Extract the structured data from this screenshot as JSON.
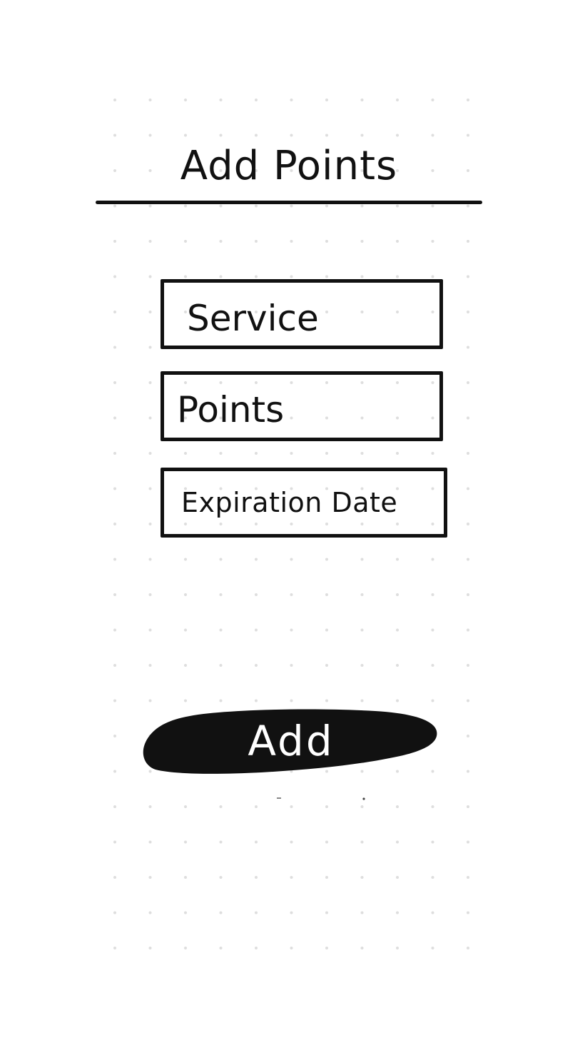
{
  "screen": {
    "title": "Add Points"
  },
  "form": {
    "service_placeholder": "Service",
    "points_placeholder": "Points",
    "expiration_placeholder": "Expiration Date"
  },
  "actions": {
    "add_label": "Add"
  },
  "colors": {
    "ink": "#111111",
    "background": "#ffffff",
    "grid_dot": "#dedede"
  }
}
